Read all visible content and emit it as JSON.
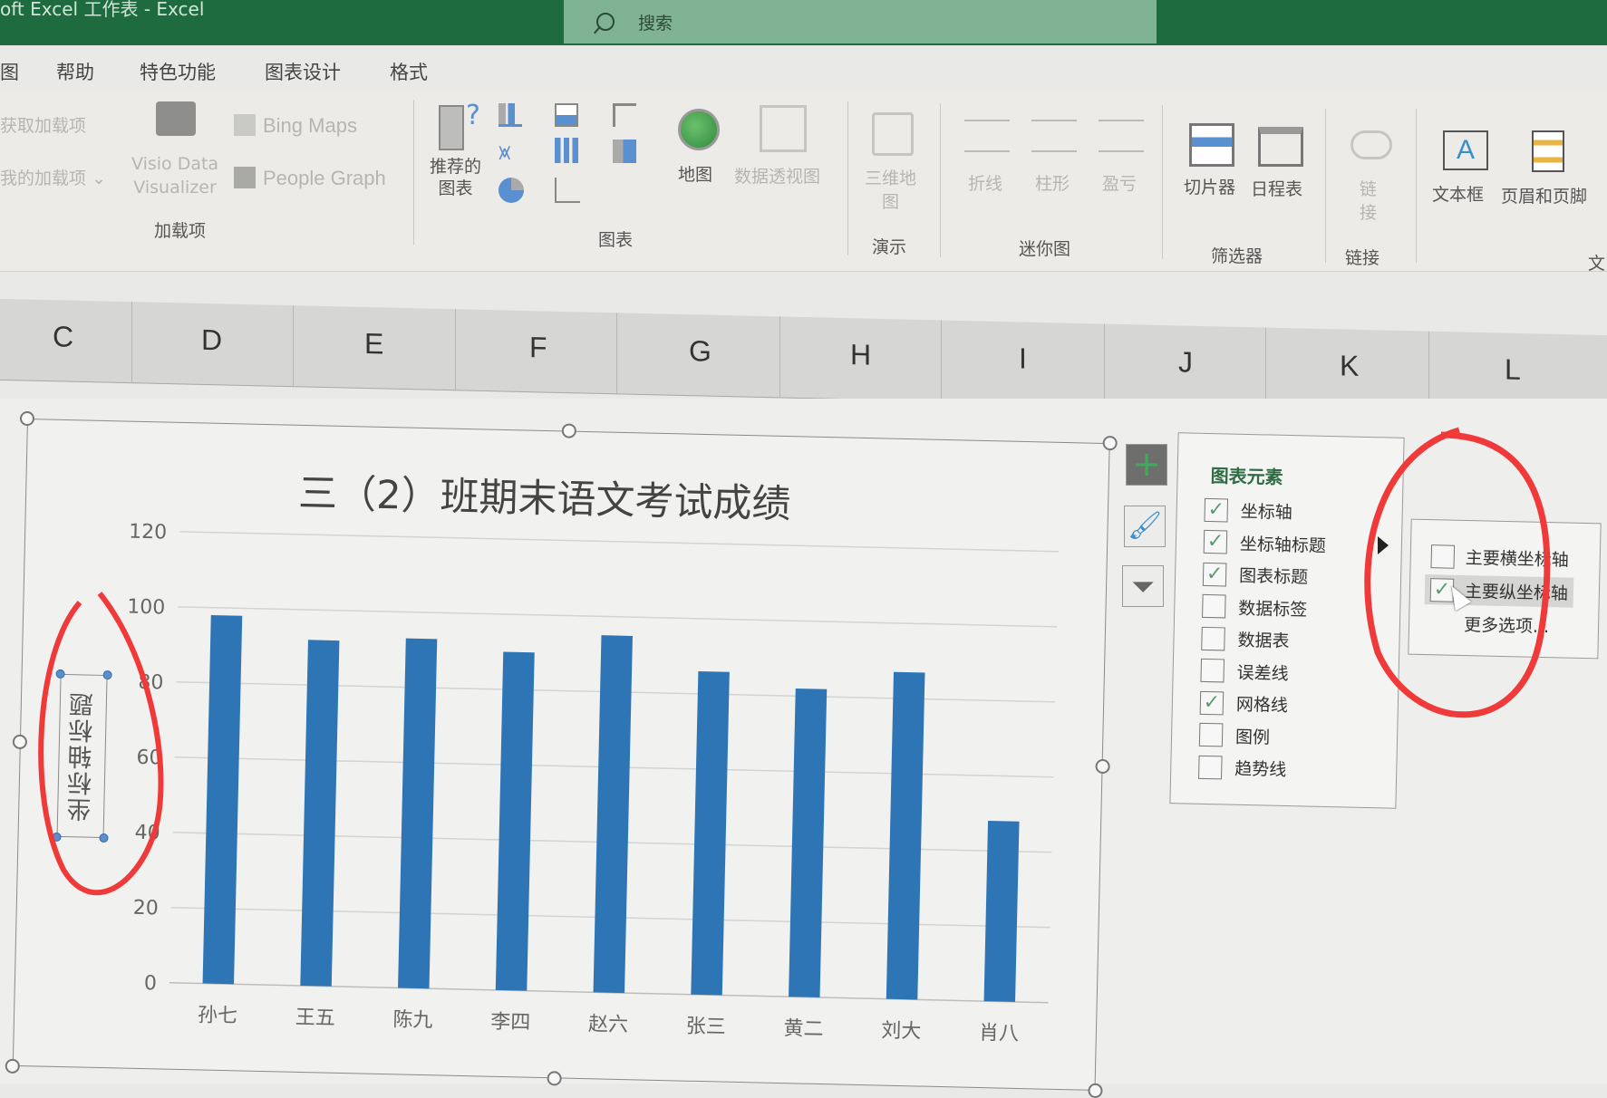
{
  "app": {
    "title": "oft Excel 工作表  -  Excel",
    "search_placeholder": "搜索",
    "search_icon": "magnifier-icon"
  },
  "menu_tabs": [
    "图",
    "帮助",
    "特色功能",
    "图表设计",
    "格式"
  ],
  "ribbon": {
    "addins": {
      "get_addins": "获取加载项",
      "my_addins": "我的加载项",
      "visio": [
        "Visio Data",
        "Visualizer"
      ],
      "bing_maps": "Bing Maps",
      "people_graph": "People Graph",
      "group_label": "加载项"
    },
    "charts": {
      "recommended": [
        "推荐的",
        "图表"
      ],
      "group_label": "图表",
      "map": "地图",
      "pivot_chart": "数据透视图"
    },
    "tours": {
      "label": [
        "三维地",
        "图"
      ],
      "group_label": "演示"
    },
    "sparklines": {
      "line": "折线",
      "column": "柱形",
      "winloss": "盈亏",
      "group_label": "迷你图"
    },
    "filters": {
      "slicer": "切片器",
      "timeline": "日程表",
      "group_label": "筛选器"
    },
    "links": {
      "link": [
        "链",
        "接"
      ],
      "group_label": "链接"
    },
    "text": {
      "textbox": "文本框",
      "header_footer": "页眉和页脚",
      "group_label": "文"
    }
  },
  "columns": [
    "C",
    "D",
    "E",
    "F",
    "G",
    "H",
    "I",
    "J",
    "K",
    "L"
  ],
  "chart_data": {
    "type": "bar",
    "title": "三（2）班期末语文考试成绩",
    "xlabel": "",
    "ylabel": "坐标轴标题",
    "categories": [
      "孙七",
      "王五",
      "陈九",
      "李四",
      "赵六",
      "张三",
      "黄二",
      "刘大",
      "肖八"
    ],
    "values": [
      98,
      92,
      93,
      90,
      95,
      86,
      82,
      87,
      48
    ],
    "ylim": [
      0,
      120
    ],
    "yticks": [
      "0",
      "20",
      "40",
      "60",
      "80",
      "100",
      "120"
    ],
    "grid": true,
    "legend": "none",
    "bar_color": "#2e75b6"
  },
  "chart_buttons": {
    "add_element": "plus-icon",
    "styles": "brush-icon",
    "filter": "funnel-icon"
  },
  "chart_elements_panel": {
    "title": "图表元素",
    "items": [
      {
        "label": "坐标轴",
        "checked": true
      },
      {
        "label": "坐标轴标题",
        "checked": true
      },
      {
        "label": "图表标题",
        "checked": true
      },
      {
        "label": "数据标签",
        "checked": false
      },
      {
        "label": "数据表",
        "checked": false
      },
      {
        "label": "误差线",
        "checked": false
      },
      {
        "label": "网格线",
        "checked": true
      },
      {
        "label": "图例",
        "checked": false
      },
      {
        "label": "趋势线",
        "checked": false
      }
    ]
  },
  "axis_title_submenu": {
    "items": [
      {
        "label": "主要横坐标轴",
        "checked": false
      },
      {
        "label": "主要纵坐标轴",
        "checked": true
      }
    ],
    "more": "更多选项..."
  },
  "checkmark": "✓",
  "colors": {
    "titlebar": "#1e6b3f",
    "annotation": "#f03a3a"
  }
}
